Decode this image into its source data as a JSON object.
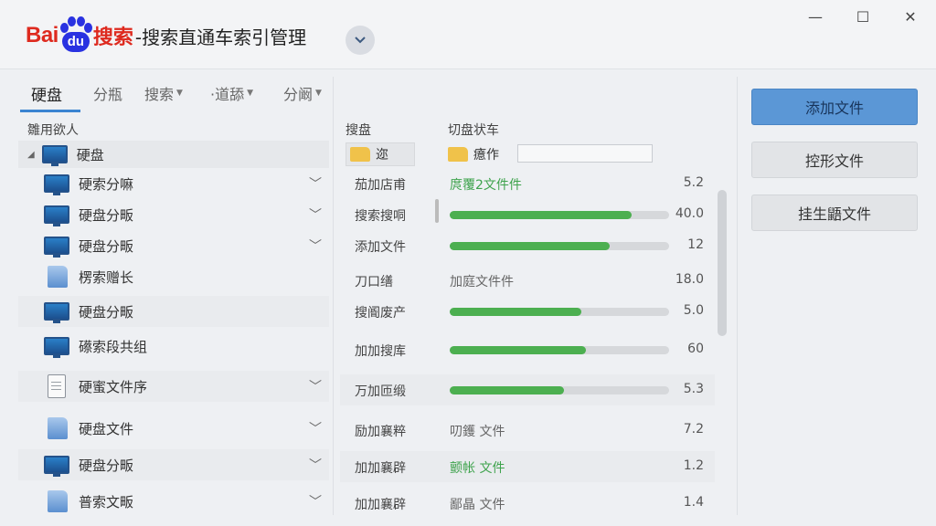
{
  "app": {
    "logo_bai": "Bai",
    "logo_du": "du",
    "logo_sousuo": "搜索",
    "title": "-搜索直通车索引管理"
  },
  "window": {
    "minimize": "—",
    "maximize": "☐",
    "close": "✕"
  },
  "tabs": [
    {
      "label": "硬盘",
      "active": true,
      "caret": false
    },
    {
      "label": "分瓶",
      "active": false,
      "caret": false
    },
    {
      "label": "搜索",
      "active": false,
      "caret": true
    },
    {
      "label": "·道舔",
      "active": false,
      "caret": true
    },
    {
      "label": "分阚",
      "active": false,
      "caret": true
    }
  ],
  "left": {
    "header": "雛用欲人",
    "root": {
      "label": "硬盘",
      "icon": "monitor-icon"
    },
    "items": [
      {
        "label": "硬索分嘛",
        "icon": "monitor-icon",
        "chevron": true,
        "shaded": false
      },
      {
        "label": "硬盘分畈",
        "icon": "monitor-icon",
        "chevron": true,
        "shaded": false
      },
      {
        "label": "硬盘分畈",
        "icon": "monitor-icon",
        "chevron": true,
        "shaded": false
      },
      {
        "label": "楞索赠长",
        "icon": "folder-icon",
        "chevron": false,
        "shaded": false
      },
      {
        "label": "硬盘分畈",
        "icon": "monitor-icon",
        "chevron": false,
        "shaded": true
      },
      {
        "label": "礤索段共组",
        "icon": "monitor-icon",
        "chevron": false,
        "shaded": false
      },
      {
        "label": "硬蜜文件序",
        "icon": "document-icon",
        "chevron": true,
        "shaded": true
      },
      {
        "label": "硬盘文件",
        "icon": "folder-icon",
        "chevron": true,
        "shaded": false
      },
      {
        "label": "硬盘分畈",
        "icon": "monitor-icon",
        "chevron": true,
        "shaded": true
      },
      {
        "label": "普索文畈",
        "icon": "folder-icon",
        "chevron": true,
        "shaded": false
      }
    ]
  },
  "middle": {
    "header_a": "搜盘",
    "header_b": "切盘状车",
    "folder_a": "迩",
    "folder_b": "癔作",
    "search_value": "",
    "rows": [
      {
        "name": "茄加店甫",
        "text": "庹覆2文件件",
        "text_green": true,
        "progress": null,
        "value": "5.2",
        "shaded": false
      },
      {
        "name": "搜索搜哃",
        "text": "",
        "text_green": false,
        "progress": 0.83,
        "value": "40.0",
        "shaded": false
      },
      {
        "name": "添加文件",
        "text": "",
        "text_green": false,
        "progress": 0.73,
        "value": "12",
        "shaded": false
      },
      {
        "name": "刀口缮",
        "text": "加庭文件件",
        "text_green": false,
        "progress": null,
        "value": "18.0",
        "shaded": false
      },
      {
        "name": "搜阍废产",
        "text": "",
        "text_green": false,
        "progress": 0.6,
        "value": "5.0",
        "shaded": false
      },
      {
        "name": "加加搜库",
        "text": "",
        "text_green": false,
        "progress": 0.62,
        "value": "60",
        "shaded": false
      },
      {
        "name": "万加匝缎",
        "text": "",
        "text_green": false,
        "progress": 0.52,
        "value": "5.3",
        "shaded": true
      },
      {
        "name": "励加襄粹",
        "text": "叨鑊 文件",
        "text_green": false,
        "progress": null,
        "value": "7.2",
        "shaded": false
      },
      {
        "name": "加加襄辟",
        "text": "颤帐 文件",
        "text_green": true,
        "progress": null,
        "value": "1.2",
        "shaded": true
      },
      {
        "name": "加加襄辟",
        "text": "鄙晶 文件",
        "text_green": false,
        "progress": null,
        "value": "1.4",
        "shaded": false
      }
    ]
  },
  "buttons": {
    "add_file": "添加文件",
    "shape_file": "控形文件",
    "generate_file": "挂生鼯文件"
  },
  "colors": {
    "brand_red": "#de2a1f",
    "brand_blue": "#2932e1",
    "accent": "#3b84d1",
    "progress": "#4caf50"
  }
}
